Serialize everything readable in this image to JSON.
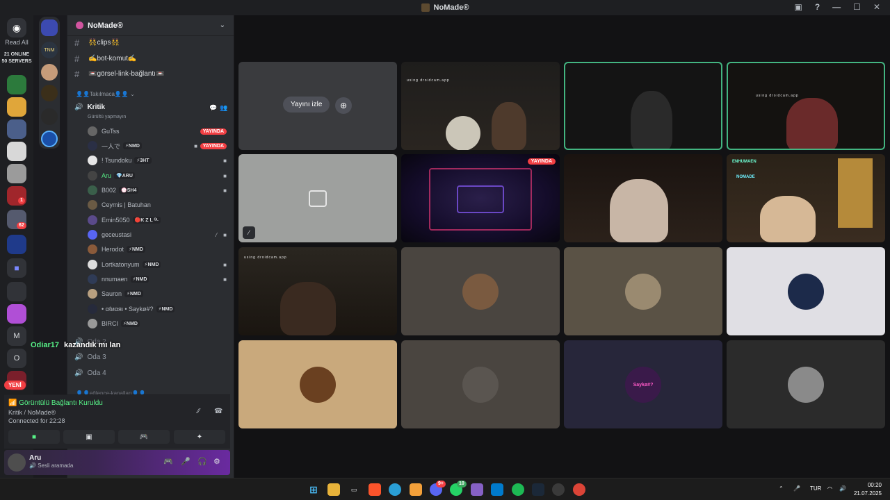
{
  "window": {
    "title": "NoMade®"
  },
  "guilds": {
    "read_all": "Read All",
    "online": "21 ONLINE",
    "servers": "50 SERVERS",
    "badge_1": "1",
    "badge_62": "62",
    "letter_m": "M",
    "letter_o": "O",
    "yeni": "YENİ",
    "tnm": "TNM"
  },
  "sidebar": {
    "server_name": "NoMade®",
    "channels": [
      {
        "name": "👯clips👯"
      },
      {
        "name": "✍️bot-komut✍️"
      },
      {
        "name": "📼görsel-link-bağlantı📼"
      }
    ],
    "category": "👤👤Takılmaca👤👤",
    "voice_channel": {
      "name": "Kritik",
      "status": "Gürültü yapmayın"
    },
    "members": [
      {
        "name": "GuTss",
        "tag": "",
        "live": "YAYINDA"
      },
      {
        "name": "一人で",
        "tag": "⚡NMD",
        "live": "YAYINDA"
      },
      {
        "name": "! Tsundoku",
        "tag": "⚡3HT",
        "live": ""
      },
      {
        "name": "Aru",
        "tag": "💎ARU",
        "live": ""
      },
      {
        "name": "B002",
        "tag": "💮SH4",
        "live": ""
      },
      {
        "name": "Ceymis | Batuhan",
        "tag": "",
        "live": ""
      },
      {
        "name": "Emin5050",
        "tag": "🔴K Z L ᴳᴸ",
        "live": ""
      },
      {
        "name": "geceustasi",
        "tag": "",
        "live": ""
      },
      {
        "name": "Herodot",
        "tag": "⚡NMD",
        "live": ""
      },
      {
        "name": "Lortkatonyum",
        "tag": "⚡NMD",
        "live": ""
      },
      {
        "name": "nnumaen",
        "tag": "⚡NMD",
        "live": ""
      },
      {
        "name": "Sauron",
        "tag": "⚡NMD",
        "live": ""
      },
      {
        "name": "• αℓиαяι • Saykø#?",
        "tag": "⚡NMD",
        "live": ""
      },
      {
        "name": "BIRCI",
        "tag": "⚡NMD",
        "live": ""
      }
    ],
    "voice_oda2": "Oda 2",
    "voice_oda3": "Oda 3",
    "voice_oda4": "Oda 4",
    "category2": "👤👤eğlence-kanalları👤👤"
  },
  "chat_overlay": {
    "user": "Odiar17",
    "message": "kazandık mı lan"
  },
  "connection": {
    "title": "Görüntülü Bağlantı Kuruldu",
    "subtitle": "Kritik / NoMade®",
    "duration": "Connected for 22:28"
  },
  "user_panel": {
    "name": "Aru",
    "status": "Sesli aramada"
  },
  "stage": {
    "watch_label": "Yayını izle",
    "watermark": "using droidcam.app",
    "live_label": "YAYINDA",
    "neon_text": "ENHUMAEN",
    "nomade_sign": "NOMADE",
    "avatar_text": "Saykø#?",
    "avatar_caption": "YAYINDA",
    "small_caption": "• αℓиαяι •"
  },
  "taskbar": {
    "lang": "TUR",
    "time": "00:20",
    "date": "21.07.2025",
    "discord_badge": "9+",
    "whatsapp_badge": "10"
  },
  "colors": {
    "accent": "#5865f2",
    "live": "#f23f43",
    "online": "#57f287",
    "speaking_border": "#43b581"
  }
}
